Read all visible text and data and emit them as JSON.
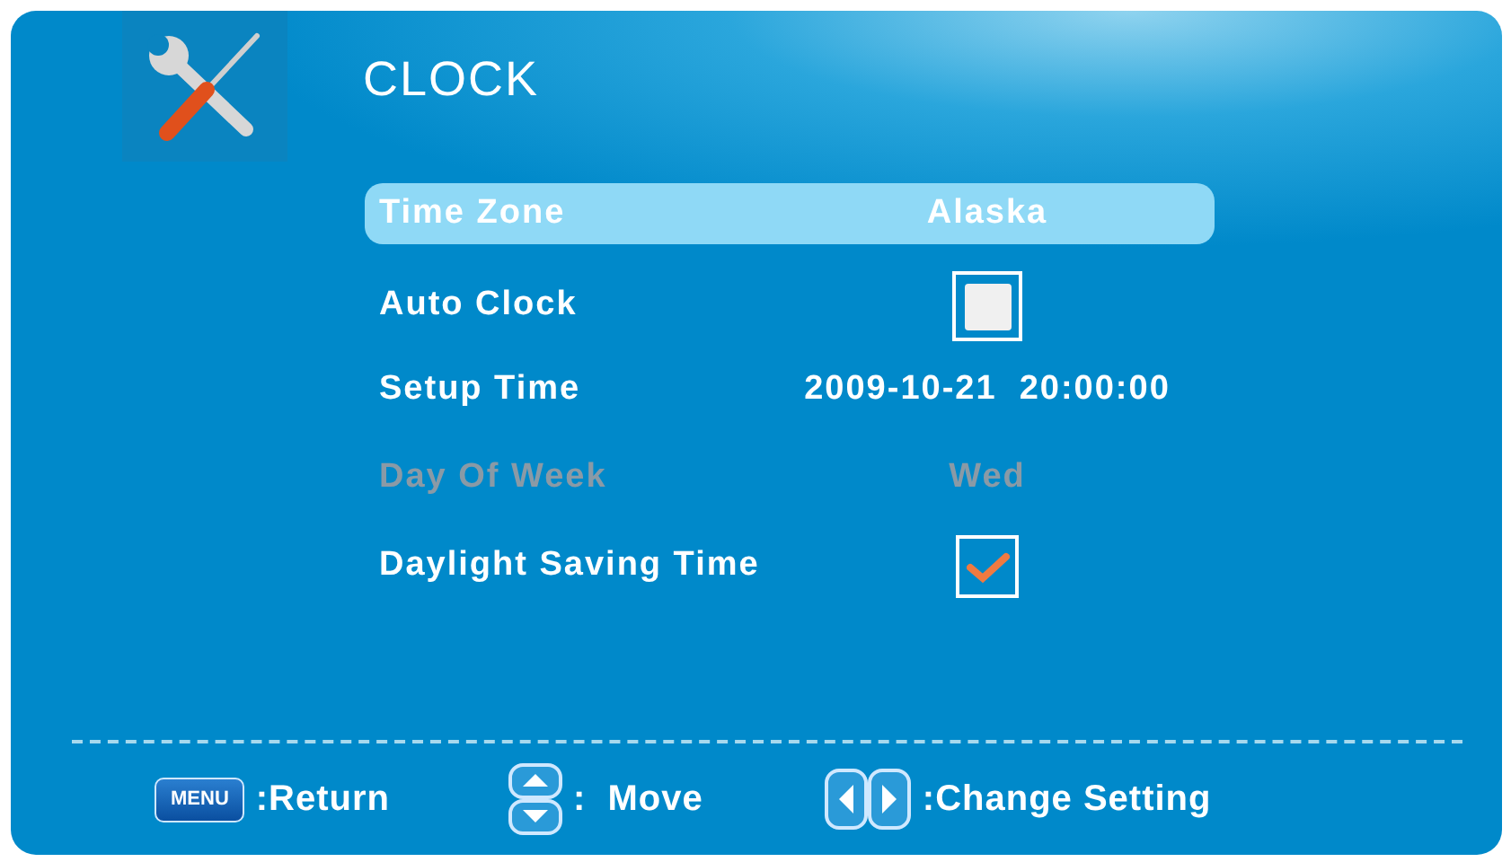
{
  "title": "CLOCK",
  "items": [
    {
      "kind": "value",
      "label": "Time Zone",
      "value": "Alaska",
      "selected": true,
      "disabled": false
    },
    {
      "kind": "checkbox",
      "label": "Auto Clock",
      "checked": false,
      "selected": false,
      "disabled": false
    },
    {
      "kind": "value",
      "label": "Setup Time",
      "value": "2009-10-21  20:00:00",
      "selected": false,
      "disabled": false
    },
    {
      "kind": "value",
      "label": "Day Of Week",
      "value": "Wed",
      "selected": false,
      "disabled": true
    },
    {
      "kind": "checkbox",
      "label": "Daylight Saving Time",
      "checked": true,
      "selected": false,
      "disabled": false
    }
  ],
  "hints": [
    {
      "kind": "menu",
      "key": "MENU",
      "text": ":Return"
    },
    {
      "kind": "updown",
      "text": ":  Move"
    },
    {
      "kind": "leftright",
      "text": ":Change Setting"
    }
  ]
}
